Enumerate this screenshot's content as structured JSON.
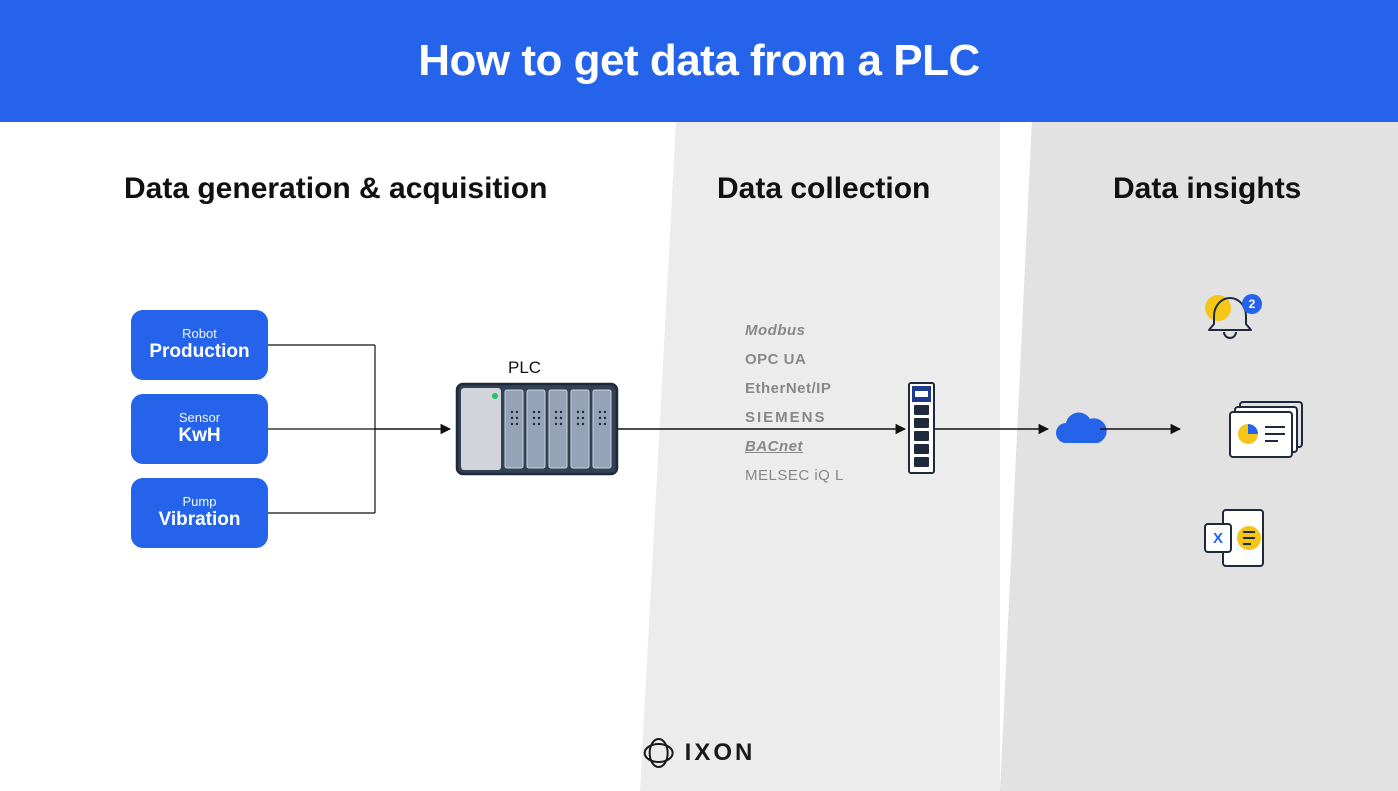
{
  "title": "How to get data from a PLC",
  "sections": {
    "s1": "Data generation & acquisition",
    "s2": "Data collection",
    "s3": "Data insights"
  },
  "sources": [
    {
      "type": "Robot",
      "metric": "Production"
    },
    {
      "type": "Sensor",
      "metric": "KwH"
    },
    {
      "type": "Pump",
      "metric": "Vibration"
    }
  ],
  "plc_label": "PLC",
  "protocols": [
    "Modbus",
    "OPC UA",
    "EtherNet/IP",
    "SIEMENS",
    "BACnet",
    "MELSEC iQ L"
  ],
  "insights": {
    "notification_badge": "2"
  },
  "brand": "IXON",
  "colors": {
    "blue": "#2563eb",
    "yellow": "#f5c518",
    "navy": "#1e293b"
  }
}
